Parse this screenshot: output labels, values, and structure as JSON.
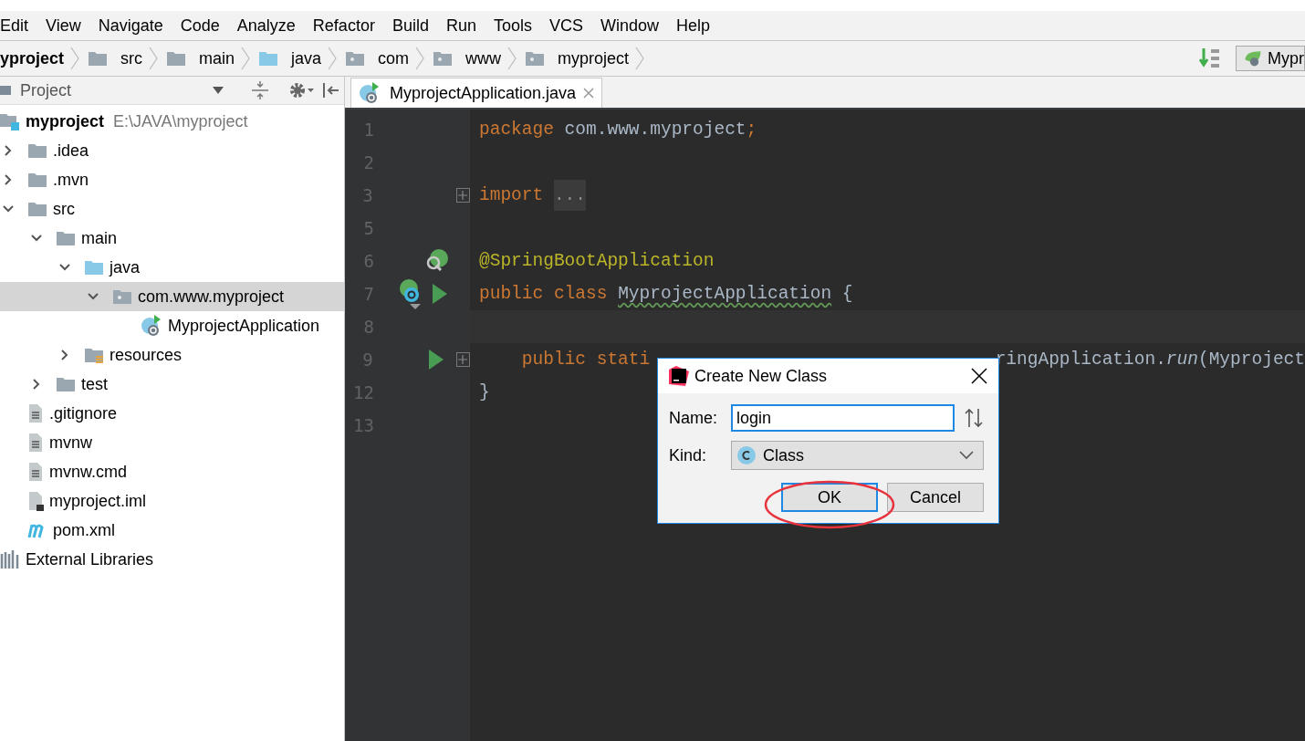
{
  "menu": [
    "Edit",
    "View",
    "Navigate",
    "Code",
    "Analyze",
    "Refactor",
    "Build",
    "Run",
    "Tools",
    "VCS",
    "Window",
    "Help"
  ],
  "breadcrumb": [
    {
      "label": "yproject",
      "kind": "project"
    },
    {
      "label": "src",
      "kind": "folder"
    },
    {
      "label": "main",
      "kind": "folder"
    },
    {
      "label": "java",
      "kind": "source"
    },
    {
      "label": "com",
      "kind": "package"
    },
    {
      "label": "www",
      "kind": "package"
    },
    {
      "label": "myproject",
      "kind": "package"
    }
  ],
  "run_config": {
    "label": "Mypr"
  },
  "project_panel": {
    "title": "Project",
    "tree": [
      {
        "label": "myproject",
        "path": "E:\\JAVA\\myproject",
        "kind": "module",
        "selected": false,
        "children": [
          {
            "label": ".idea",
            "kind": "folder",
            "expanded": false,
            "selected": false
          },
          {
            "label": ".mvn",
            "kind": "folder",
            "expanded": false,
            "selected": false
          },
          {
            "label": "src",
            "kind": "folder",
            "expanded": true,
            "selected": false,
            "children": [
              {
                "label": "main",
                "kind": "folder",
                "expanded": true,
                "selected": false,
                "children": [
                  {
                    "label": "java",
                    "kind": "source",
                    "expanded": true,
                    "selected": false,
                    "children": [
                      {
                        "label": "com.www.myproject",
                        "kind": "package",
                        "expanded": true,
                        "selected": true,
                        "children": [
                          {
                            "label": "MyprojectApplication",
                            "kind": "spring-class",
                            "selected": false
                          }
                        ]
                      }
                    ]
                  },
                  {
                    "label": "resources",
                    "kind": "resources",
                    "expanded": false,
                    "selected": false
                  }
                ]
              },
              {
                "label": "test",
                "kind": "folder",
                "expanded": false,
                "selected": false
              }
            ]
          },
          {
            "label": ".gitignore",
            "kind": "file",
            "selected": false
          },
          {
            "label": "mvnw",
            "kind": "file",
            "selected": false
          },
          {
            "label": "mvnw.cmd",
            "kind": "file",
            "selected": false
          },
          {
            "label": "myproject.iml",
            "kind": "iml",
            "selected": false
          },
          {
            "label": "pom.xml",
            "kind": "maven",
            "selected": false
          }
        ]
      },
      {
        "label": "External Libraries",
        "kind": "libraries",
        "selected": false
      }
    ]
  },
  "editor": {
    "tabs": [
      {
        "label": "MyprojectApplication.java",
        "selected": true
      }
    ],
    "lines": [
      {
        "number": "1",
        "tokens": [
          {
            "kind": "keyword",
            "text": "package"
          },
          {
            "kind": "plain",
            "text": " com.www.myproject"
          },
          {
            "kind": "keyword",
            "text": ";"
          }
        ]
      },
      {
        "number": "2"
      },
      {
        "number": "3",
        "fold": true,
        "tokens": [
          {
            "kind": "keyword",
            "text": "import "
          },
          {
            "kind": "folded",
            "text": "..."
          }
        ]
      },
      {
        "number": "5"
      },
      {
        "number": "6",
        "gutter": [
          {
            "kind": "bean-search"
          }
        ],
        "tokens": [
          {
            "kind": "annotation",
            "text": "@SpringBootApplication"
          }
        ]
      },
      {
        "number": "7",
        "gutter": [
          {
            "kind": "bean-class"
          },
          {
            "kind": "run"
          }
        ],
        "tokens": [
          {
            "kind": "keyword",
            "text": "public class "
          },
          {
            "kind": "typo",
            "text": "MyprojectApplication"
          },
          {
            "kind": "plain",
            "text": " {"
          }
        ]
      },
      {
        "number": "8",
        "current": true
      },
      {
        "number": "9",
        "fold": true,
        "gutter": [
          {
            "kind": "run"
          }
        ],
        "tokens": [
          {
            "kind": "keyword",
            "text": "    public stati"
          }
        ],
        "tail_tokens": [
          {
            "kind": "plain",
            "text": "ringApplication."
          },
          {
            "kind": "italic",
            "text": "run"
          },
          {
            "kind": "plain",
            "text": "(Myproject"
          }
        ]
      },
      {
        "number": "12",
        "tokens": [
          {
            "kind": "plain",
            "text": "}"
          }
        ]
      },
      {
        "number": "13"
      }
    ]
  },
  "dialog": {
    "title": "Create New Class",
    "name_label": "Name:",
    "name_value": "login",
    "kind_label": "Kind:",
    "kind_value": "Class",
    "buttons": [
      {
        "label": "OK",
        "default": true,
        "circled": true
      },
      {
        "label": "Cancel",
        "default": false,
        "circled": false
      }
    ]
  }
}
